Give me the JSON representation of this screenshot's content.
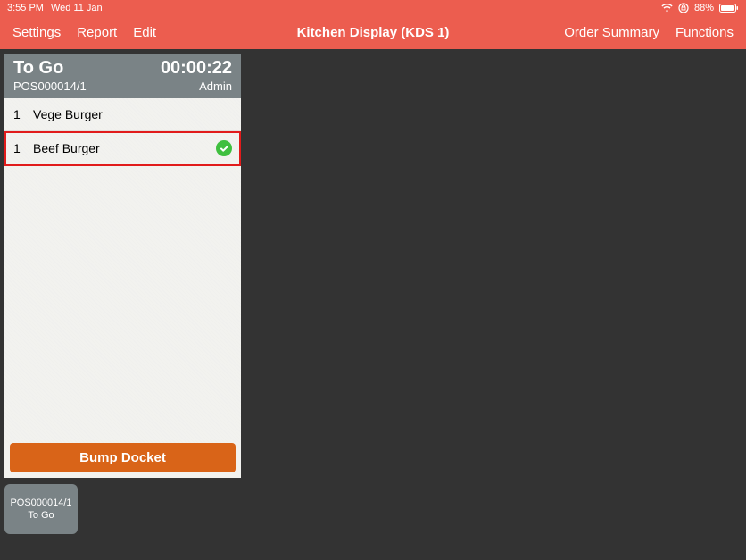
{
  "status_bar": {
    "time": "3:55 PM",
    "date": "Wed 11 Jan",
    "battery": "88%"
  },
  "nav": {
    "left": {
      "settings": "Settings",
      "report": "Report",
      "edit": "Edit"
    },
    "title": "Kitchen Display (KDS 1)",
    "right": {
      "order_summary": "Order Summary",
      "functions": "Functions"
    }
  },
  "order": {
    "type": "To Go",
    "timer": "00:00:22",
    "id": "POS000014/1",
    "user": "Admin",
    "items": [
      {
        "qty": "1",
        "name": "Vege Burger",
        "checked": false,
        "highlighted": false
      },
      {
        "qty": "1",
        "name": "Beef Burger",
        "checked": true,
        "highlighted": true
      }
    ],
    "bump_label": "Bump Docket"
  },
  "bottom_tab": {
    "line1": "POS000014/1",
    "line2": "To Go"
  }
}
